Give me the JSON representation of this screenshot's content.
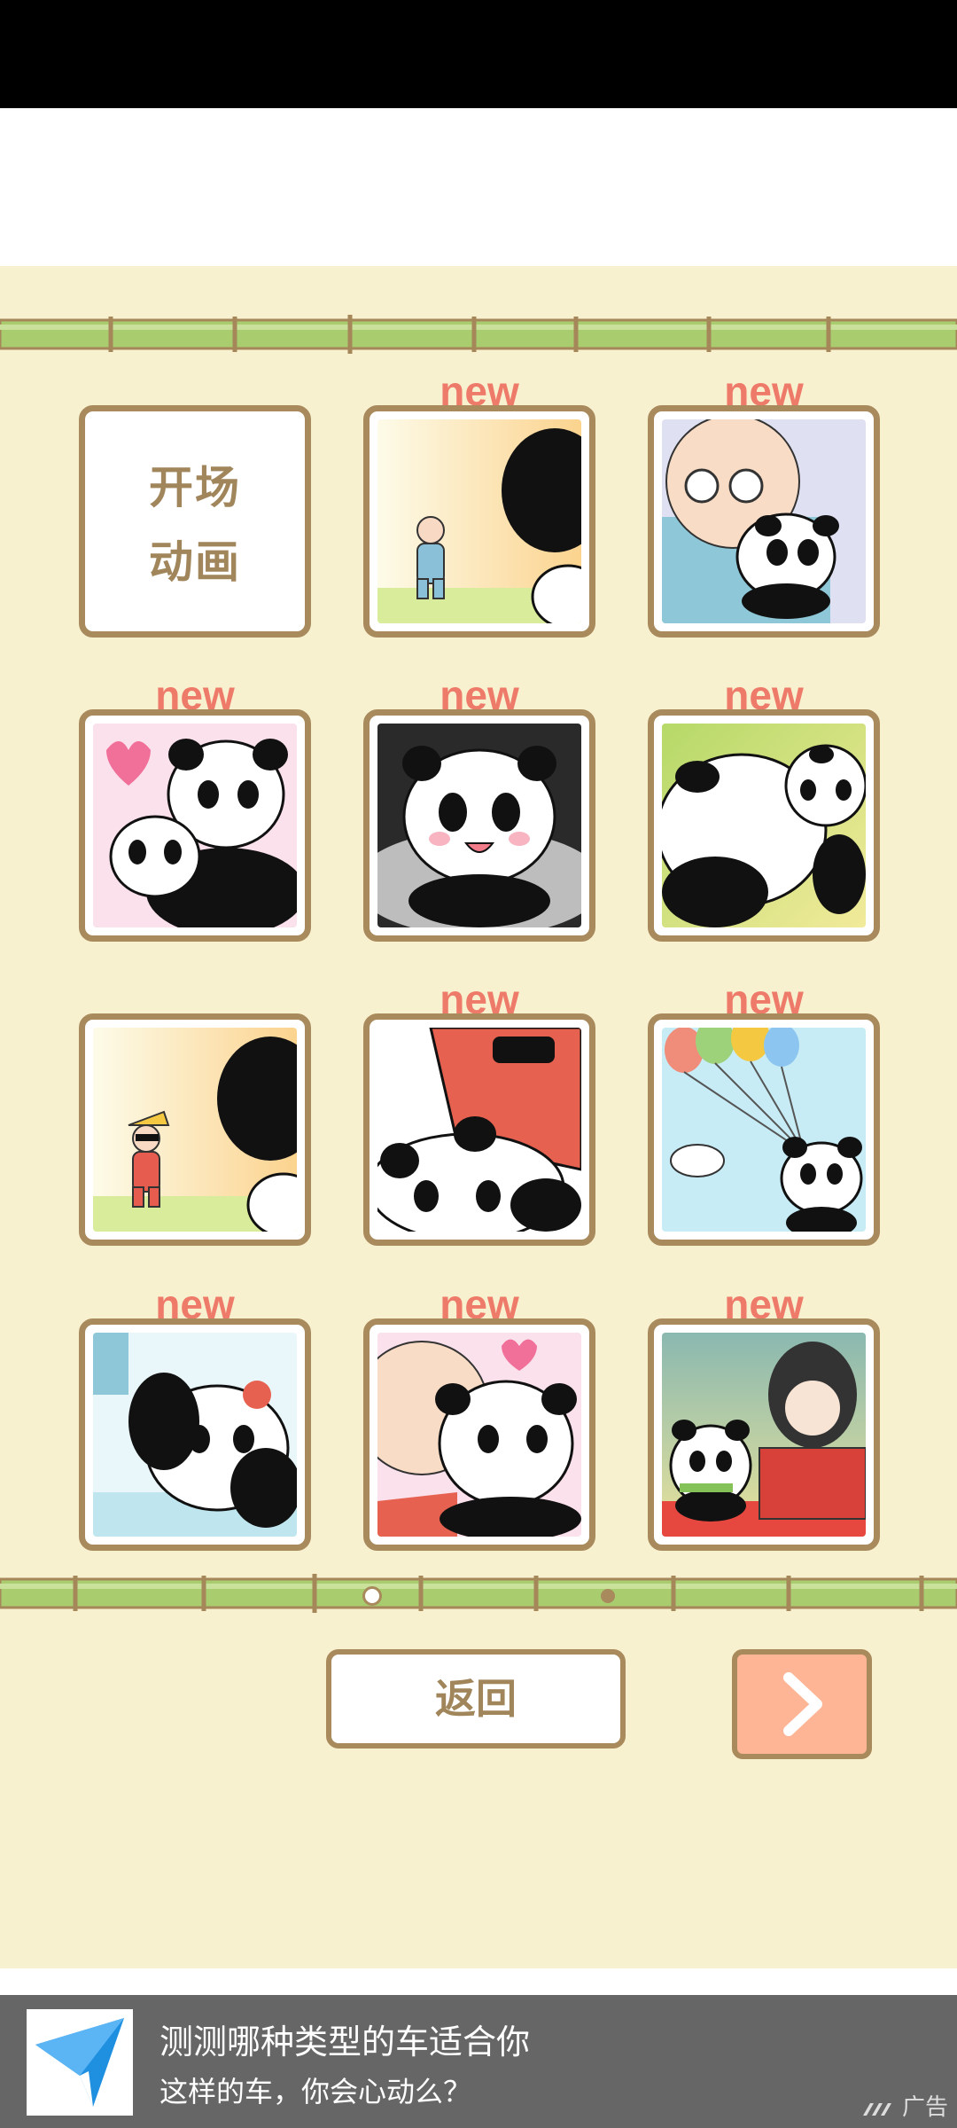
{
  "gallery": {
    "intro_tile": {
      "line1": "开场",
      "line2": "动画"
    },
    "new_label": "new",
    "tiles": [
      {
        "name": "intro",
        "is_new": false
      },
      {
        "name": "old-man-running-to-panda",
        "is_new": true
      },
      {
        "name": "old-man-hugging-panda",
        "is_new": true
      },
      {
        "name": "panda-parent-hugging-cub",
        "is_new": true
      },
      {
        "name": "panda-in-pot",
        "is_new": true
      },
      {
        "name": "pandas-lying-on-grass",
        "is_new": true
      },
      {
        "name": "sunglasses-man-running-to-panda",
        "is_new": false
      },
      {
        "name": "panda-with-red-jacket-man",
        "is_new": true
      },
      {
        "name": "panda-with-balloons-and-bird",
        "is_new": true
      },
      {
        "name": "panda-crying-lying-down",
        "is_new": true
      },
      {
        "name": "old-man-kissing-panda",
        "is_new": true
      },
      {
        "name": "panda-with-kimono-girl",
        "is_new": true
      }
    ],
    "page_indicator": {
      "pages": 2,
      "current": 1
    }
  },
  "buttons": {
    "back_label": "返回",
    "next_icon": "chevron-right-icon"
  },
  "ad": {
    "title": "测测哪种类型的车适合你",
    "subtitle": "这样的车，你会心动么？",
    "tag": "广告",
    "logo_icon": "paper-plane-logo"
  },
  "colors": {
    "background": "#f8f1d0",
    "frame": "#a88a5c",
    "new_tag": "#ee7a6a",
    "next_button": "#fdb595",
    "bamboo": "#a9cc6e"
  }
}
